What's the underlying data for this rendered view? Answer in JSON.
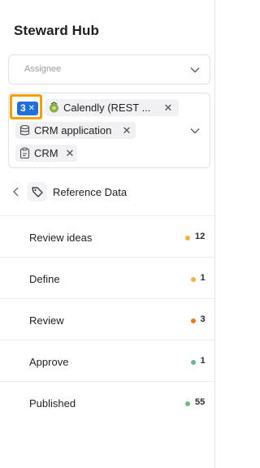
{
  "header": {
    "title": "Steward Hub"
  },
  "assignee": {
    "placeholder": "Assignee"
  },
  "filters": {
    "count_label": "3",
    "chips": [
      {
        "label": "Calendly (REST ...",
        "icon": "app-integration-icon"
      },
      {
        "label": "CRM application",
        "icon": "database-icon"
      },
      {
        "label": "CRM",
        "icon": "clipboard-icon"
      }
    ]
  },
  "breadcrumb": {
    "label": "Reference Data",
    "icon": "tag-icon"
  },
  "stages": [
    {
      "label": "Review ideas",
      "count": "12",
      "color": "#f5b23a"
    },
    {
      "label": "Define",
      "count": "1",
      "color": "#f5b23a"
    },
    {
      "label": "Review",
      "count": "3",
      "color": "#ee7a10"
    },
    {
      "label": "Approve",
      "count": "1",
      "color": "#6fb789"
    },
    {
      "label": "Published",
      "count": "55",
      "color": "#6fb789"
    }
  ]
}
